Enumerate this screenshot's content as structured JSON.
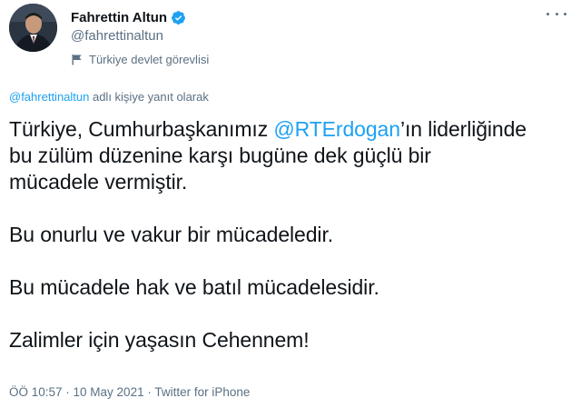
{
  "author": {
    "display_name": "Fahrettin Altun",
    "handle": "@fahrettinaltun",
    "account_label": "Türkiye devlet görevlisi"
  },
  "reply": {
    "handle": "@fahrettinaltun",
    "suffix": " adlı kişiye yanıt olarak"
  },
  "tweet": {
    "line1_before": "Türkiye, Cumhurbaşkanımız ",
    "mention": "@RTErdogan",
    "line1_after": "’ın liderliğinde",
    "line2": "bu zülüm düzenine karşı bugüne dek güçlü bir",
    "line3": "mücadele vermiştir.",
    "para2": "Bu onurlu ve vakur bir mücadeledir.",
    "para3": "Bu mücadele hak ve batıl mücadelesidir.",
    "para4": "Zalimler için yaşasın Cehennem!"
  },
  "meta": {
    "text": "ÖÖ 10:57 · 10 May 2021 · Twitter for iPhone"
  },
  "icons": {
    "verified": "verified-badge-icon",
    "label": "flag-icon",
    "more": "more-icon"
  },
  "colors": {
    "accent": "#1da1f2",
    "secondary_text": "#5b7083",
    "primary_text": "#0f1419"
  }
}
